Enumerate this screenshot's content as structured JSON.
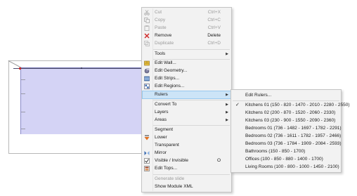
{
  "main_menu": {
    "items": [
      {
        "label": "Cut",
        "shortcut": "Ctrl+X",
        "icon": "scissors-icon",
        "disabled": true
      },
      {
        "label": "Copy",
        "shortcut": "Ctrl+C",
        "icon": "copy-icon",
        "disabled": true
      },
      {
        "label": "Paste",
        "shortcut": "Ctrl+V",
        "icon": "paste-icon",
        "disabled": true
      },
      {
        "label": "Remove",
        "shortcut": "Delete",
        "icon": "remove-icon",
        "disabled": false
      },
      {
        "label": "Duplicate",
        "shortcut": "Ctrl+D",
        "icon": "duplicate-icon",
        "disabled": true
      },
      {
        "label": "Tools",
        "submenu": true
      },
      {
        "label": "Edit Wall...",
        "icon": "wall-icon"
      },
      {
        "label": "Edit Geometry...",
        "icon": "geometry-icon"
      },
      {
        "label": "Edit Strips...",
        "icon": "strips-icon"
      },
      {
        "label": "Edit Regions...",
        "icon": "regions-icon"
      },
      {
        "label": "Rulers",
        "submenu": true,
        "highlighted": true
      },
      {
        "label": "Convert To",
        "submenu": true
      },
      {
        "label": "Layers",
        "submenu": true
      },
      {
        "label": "Areas",
        "submenu": true
      },
      {
        "label": "Segment"
      },
      {
        "label": "Lower",
        "icon": "lower-icon"
      },
      {
        "label": "Transparent"
      },
      {
        "label": "Mirror",
        "icon": "mirror-icon"
      },
      {
        "label": "Visible / Invisible",
        "shortcut": "O",
        "icon": "visible-icon"
      },
      {
        "label": "Edit Tops...",
        "icon": "tops-icon"
      },
      {
        "label": "Generate slide",
        "disabled": true
      },
      {
        "label": "Show Module XML"
      }
    ]
  },
  "rulers_submenu": {
    "items": [
      {
        "label": "Edit Rulers...",
        "checked": false
      },
      {
        "label": "Kitchens 01 (150 - 820 - 1470 - 2010 - 2280 - 2550)",
        "checked": true
      },
      {
        "label": "Kitchens 02 (200 - 870 - 1520 - 2060 - 2330)",
        "checked": false
      },
      {
        "label": "Kitchens 03 (230 - 900 - 1550 - 2090 - 2360)",
        "checked": false
      },
      {
        "label": "Bedrooms 01 (736 - 1482 - 1697 - 1782 - 2291)",
        "checked": false
      },
      {
        "label": "Bedrooms 02 (736 - 1611 - 1782 - 1957 - 2466)",
        "checked": false
      },
      {
        "label": "Bedrooms 03 (736 - 1784 - 1909 - 2084 - 2593)",
        "checked": false
      },
      {
        "label": "Bathrooms (150 - 850 - 1700)",
        "checked": false
      },
      {
        "label": "Offices (100 - 850 - 880 - 1400 - 1700)",
        "checked": false
      },
      {
        "label": "Living Rooms (100 - 800 - 1000 - 1450 - 2100)",
        "checked": false
      }
    ]
  },
  "colors": {
    "highlight": "#cce4f7",
    "wall_fill": "#d4d3f5",
    "menu_bg": "#f2f2f2"
  }
}
